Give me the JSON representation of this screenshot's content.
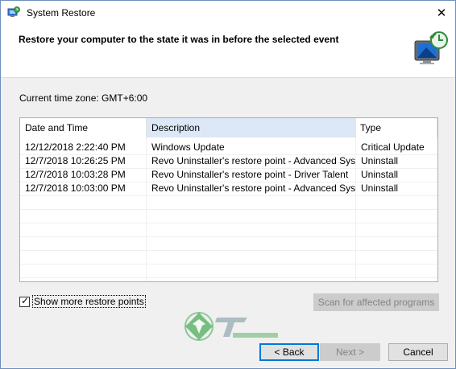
{
  "window": {
    "title": "System Restore",
    "close_glyph": "✕"
  },
  "header": {
    "title": "Restore your computer to the state it was in before the selected event",
    "icon": "system-restore-monitor-icon"
  },
  "timezone_label": "Current time zone: GMT+6:00",
  "table": {
    "columns": [
      "Date and Time",
      "Description",
      "Type"
    ],
    "sorted_column": "Description",
    "rows": [
      [
        "12/12/2018 2:22:40 PM",
        "Windows Update",
        "Critical Update"
      ],
      [
        "12/7/2018 10:26:25 PM",
        "Revo Uninstaller's restore point - Advanced Syst...",
        "Uninstall"
      ],
      [
        "12/7/2018 10:03:28 PM",
        "Revo Uninstaller's restore point - Driver Talent",
        "Uninstall"
      ],
      [
        "12/7/2018 10:03:00 PM",
        "Revo Uninstaller's restore point - Advanced Syst...",
        "Uninstall"
      ]
    ]
  },
  "show_more": {
    "label": "Show more restore points",
    "checked": true,
    "check_glyph": "✓"
  },
  "buttons": {
    "scan": "Scan for affected programs",
    "back": "< Back",
    "next": "Next >",
    "cancel": "Cancel"
  },
  "watermark": {
    "logo": "techclassy-logo"
  },
  "colors": {
    "accent": "#0078d7",
    "selected_header": "#dce8f7",
    "disabled_text": "#838383"
  }
}
